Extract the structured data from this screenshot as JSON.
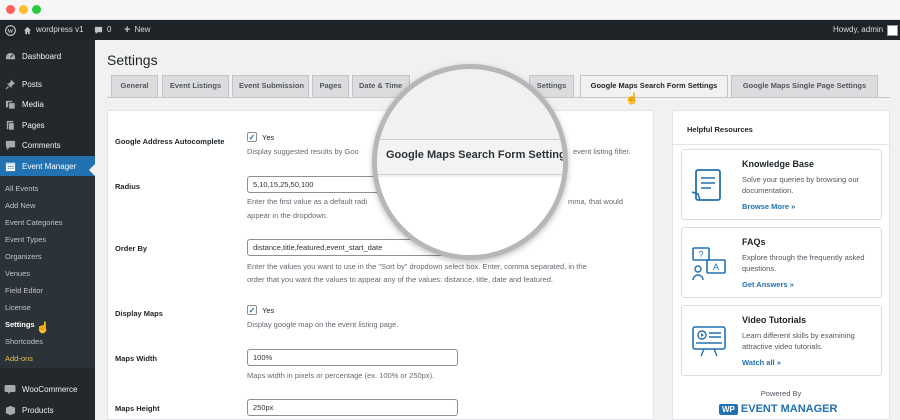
{
  "window": {
    "dots": [
      "#ff5f57",
      "#febc2e",
      "#28c840"
    ]
  },
  "adminbar": {
    "site": "wordpress v1",
    "comments": "0",
    "new": "New",
    "howdy": "Howdy, admin"
  },
  "sidebar": {
    "items": [
      {
        "label": "Dashboard",
        "icon": "dashboard-icon"
      },
      {
        "label": "Posts",
        "icon": "pin-icon"
      },
      {
        "label": "Media",
        "icon": "media-icon"
      },
      {
        "label": "Pages",
        "icon": "page-icon"
      },
      {
        "label": "Comments",
        "icon": "comment-icon"
      },
      {
        "label": "Event Manager",
        "icon": "calendar-icon"
      },
      {
        "label": "WooCommerce",
        "icon": "woo-icon"
      },
      {
        "label": "Products",
        "icon": "products-icon"
      }
    ],
    "submenu": [
      "All Events",
      "Add New",
      "Event Categories",
      "Event Types",
      "Organizers",
      "Venues",
      "Field Editor",
      "License",
      "Settings",
      "Shortcodes",
      "Add-ons"
    ]
  },
  "page": {
    "title": "Settings"
  },
  "tabs": [
    "General",
    "Event Listings",
    "Event Submission",
    "Pages",
    "Date & Time",
    "Google Maps Search Form Settings",
    "Google Maps Single Page Settings"
  ],
  "tab_partial_right": "Settings",
  "form": {
    "autocomplete": {
      "label": "Google Address Autocomplete",
      "option": "Yes",
      "desc_left": "Display suggested results by Goo",
      "desc_right": "event listing filter."
    },
    "radius": {
      "label": "Radius",
      "value": "5,10,15,25,50,100",
      "desc1_left": "Enter the first value as a default radi",
      "desc1_right": "mma, that would",
      "desc2": "appear in the dropdown."
    },
    "orderby": {
      "label": "Order By",
      "value": "distance,title,featured,event_start_date",
      "desc1": "Enter the values you want to use in the \"Sort by\" dropdown select box. Enter, comma separated, in the",
      "desc2": "order that you want the values to appear any of the values: distance, title, date and featured."
    },
    "display_maps": {
      "label": "Display Maps",
      "option": "Yes",
      "desc": "Display google map on the event listing page."
    },
    "maps_width": {
      "label": "Maps Width",
      "value": "100%",
      "desc": "Maps width in pixels or percentage (ex. 100% or 250px)."
    },
    "maps_height": {
      "label": "Maps Height",
      "value": "250px"
    }
  },
  "magnifier": {
    "text": "Google Maps Search Form Settings"
  },
  "resources": {
    "title": "Helpful Resources",
    "cards": [
      {
        "title": "Knowledge Base",
        "desc": "Solve your queries by browsing our documentation.",
        "link": "Browse More »",
        "icon": "document-icon"
      },
      {
        "title": "FAQs",
        "desc": "Explore through the frequently asked questions.",
        "link": "Get Answers »",
        "icon": "faq-icon"
      },
      {
        "title": "Video Tutorials",
        "desc": "Learn different skills by examining attractive video tutorials.",
        "link": "Watch all »",
        "icon": "video-icon"
      }
    ],
    "powered_by": "Powered By",
    "logo_wp": "WP",
    "logo_text": "EVENT MANAGER"
  },
  "colors": {
    "accent": "#2271b1",
    "sidebar": "#23282d",
    "adminbar": "#1d2327",
    "addons": "#f0b849"
  }
}
